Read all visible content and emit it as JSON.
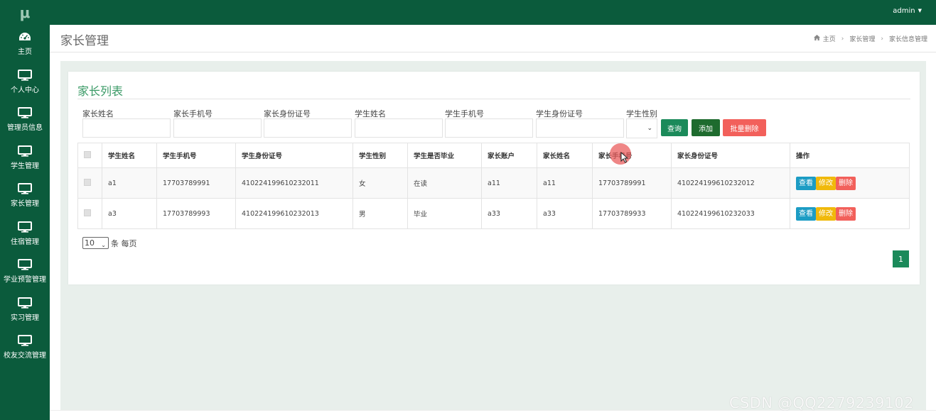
{
  "sidebar": {
    "logo": "μ",
    "items": [
      {
        "label": "主页",
        "icon": "dashboard-icon"
      },
      {
        "label": "个人中心",
        "icon": "monitor-icon"
      },
      {
        "label": "管理员信息",
        "icon": "monitor-icon"
      },
      {
        "label": "学生管理",
        "icon": "monitor-icon"
      },
      {
        "label": "家长管理",
        "icon": "monitor-icon"
      },
      {
        "label": "住宿管理",
        "icon": "monitor-icon"
      },
      {
        "label": "学业预警管理",
        "icon": "monitor-icon"
      },
      {
        "label": "实习管理",
        "icon": "monitor-icon"
      },
      {
        "label": "校友交流管理",
        "icon": "monitor-icon"
      }
    ]
  },
  "topbar": {
    "user": "admin",
    "color": "#0b5b3c"
  },
  "header": {
    "title": "家长管理",
    "breadcrumb": [
      "主页",
      "家长管理",
      "家长信息管理"
    ]
  },
  "panel": {
    "title": "家长列表"
  },
  "filters": {
    "labels": [
      "家长姓名",
      "家长手机号",
      "家长身份证号",
      "学生姓名",
      "学生手机号",
      "学生身份证号",
      "学生性别"
    ],
    "gender_selected": ""
  },
  "buttons": {
    "search": "查询",
    "add": "添加",
    "batch_delete": "批量删除"
  },
  "table": {
    "headers": [
      "学生姓名",
      "学生手机号",
      "学生身份证号",
      "学生性别",
      "学生是否毕业",
      "家长账户",
      "家长姓名",
      "家长手机号",
      "家长身份证号",
      "操作"
    ],
    "rows": [
      [
        "a1",
        "17703789991",
        "410224199610232011",
        "女",
        "在读",
        "a11",
        "a11",
        "17703789991",
        "410224199610232012"
      ],
      [
        "a3",
        "17703789993",
        "410224199610232013",
        "男",
        "毕业",
        "a33",
        "a33",
        "17703789933",
        "410224199610232033"
      ]
    ],
    "actions": {
      "view": "查看",
      "edit": "修改",
      "delete": "删除"
    }
  },
  "pagination": {
    "page_size": "10",
    "page_size_suffix": "条 每页",
    "current_page": "1"
  },
  "watermark": "CSDN @QQ2279239102",
  "colors": {
    "sidebar": "#0b5b3c",
    "search_btn": "#1b8a5a",
    "add_btn": "#1e6b2e",
    "delete_btn": "#f2605b",
    "view_btn": "#1c9cc4",
    "edit_btn": "#f0b90b"
  }
}
